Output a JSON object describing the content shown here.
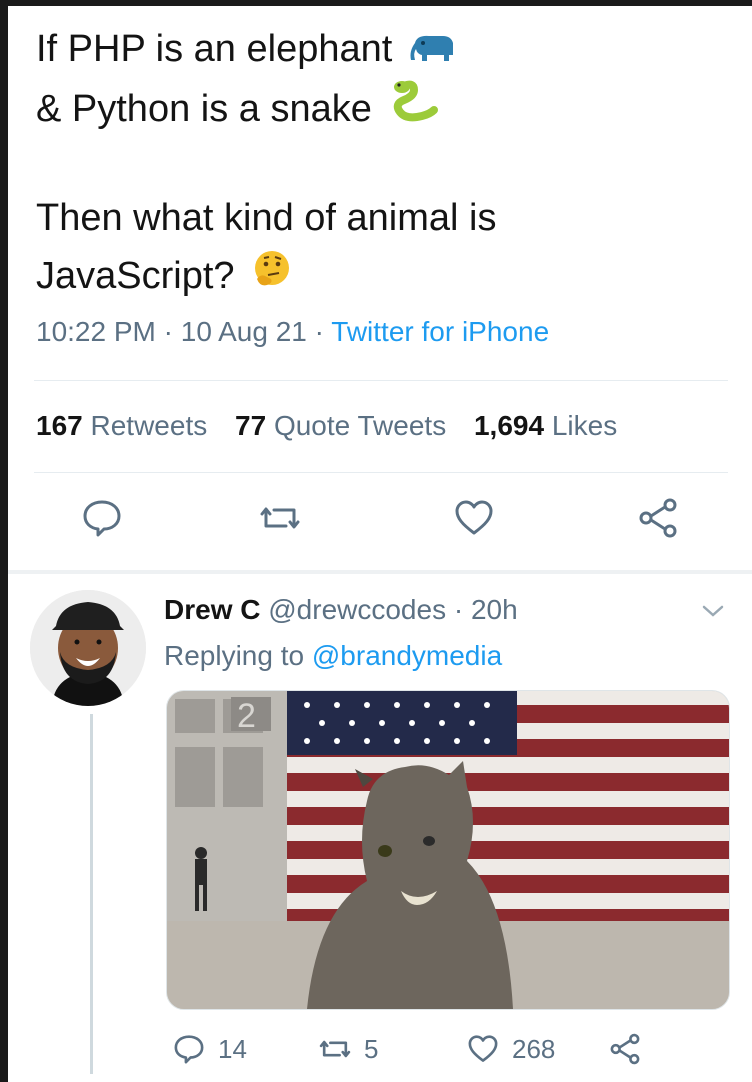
{
  "tweet": {
    "line1": "If PHP is an elephant",
    "line1_emoji": "elephant-emoji",
    "line2": "& Python is a snake",
    "line2_emoji": "snake-emoji",
    "line3": "Then what kind of animal is",
    "line4": "JavaScript?",
    "line4_emoji": "thinking-face-emoji",
    "time": "10:22 PM",
    "date": "10 Aug 21",
    "source": "Twitter for iPhone",
    "dot": "·"
  },
  "stats": {
    "retweets_count": "167",
    "retweets_label": "Retweets",
    "quotes_count": "77",
    "quotes_label": "Quote Tweets",
    "likes_count": "1,694",
    "likes_label": "Likes"
  },
  "actions": [
    "reply-icon",
    "retweet-icon",
    "like-icon",
    "share-icon"
  ],
  "reply": {
    "name": "Drew C",
    "handle": "@drewccodes",
    "dot": "·",
    "age": "20h",
    "replying_prefix": "Replying to",
    "replying_to": "@brandymedia",
    "media_sign": "2",
    "reply_count": "14",
    "retweet_count": "5",
    "like_count": "268"
  },
  "colors": {
    "accent": "#1d9bf0",
    "muted": "#5b7083",
    "text": "#141414",
    "divider": "#e6ecf0"
  }
}
